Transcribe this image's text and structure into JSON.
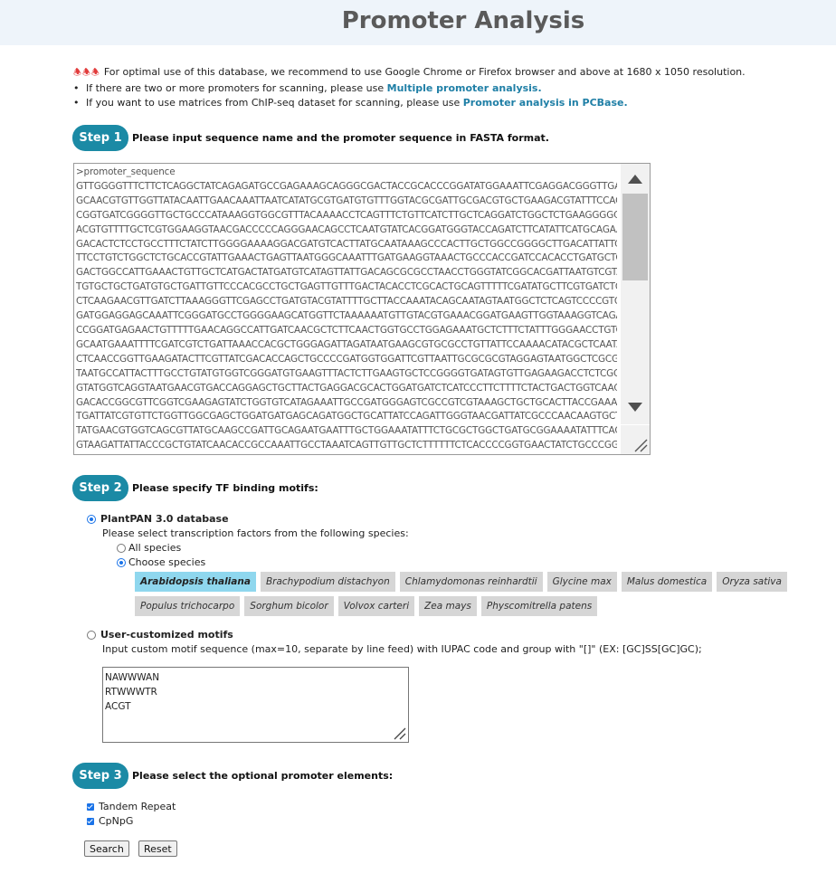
{
  "header": {
    "title": "Promoter Analysis"
  },
  "notices": {
    "browser_icon": "warning-icon",
    "browser_text": "For optimal use of this database, we recommend to use Google Chrome or Firefox browser and above at 1680 x 1050 resolution.",
    "multi_prefix": "If there are two or more promoters for scanning, please use ",
    "multi_link": "Multiple promoter analysis.",
    "chip_prefix": "If you want to use matrices from ChIP-seq dataset for scanning, please use ",
    "chip_link": "Promoter analysis in PCBase."
  },
  "step1": {
    "badge": "Step 1",
    "label": "Please input sequence name and the promoter sequence in FASTA format.",
    "sequence": ">promoter_sequence\nGTTGGGGTTTCTTCTCAGGCTATCAGAGATGCCGAGAAAGCAGGGCGACTACCGCACCCGGATATGGAAATTCGAGGACGGGTTGA\nGCAACGTGTTGGTTATACAATTGAACAAATTAATCATATGCGTGATGTGTTTGGTACGCGATTGCGACGTGCTGAAGACGTATTTCCAC\nCGGTGATCGGGGTTGCTGCCCATAAAGGTGGCGTTTACAAAACCTCAGTTTCTGTTCATCTTGCTCAGGATCTGGCTCTGAAGGGGCT\nACGTGTTTTGCTCGTGGAAGGTAACGACCCCCAGGGAACAGCCTCAATGTATCACGGATGGGTACCAGATCTTCATATTCATGCAGAA\nGACACTCTCCTGCCTTTCTATCTTGGGGAAAAGGACGATGTCACTTATGCAATAAAGCCCACTTGCTGGCCGGGGCTTGACATTATTCC\nTTCCTGTCTGGCTCTGCACCGTATTGAAACTGAGTTAATGGGCAAATTTGATGAAGGTAAACTGCCCACCGATCCACACCTGATGCTCC\nGACTGGCCATTGAAACTGTTGCTCATGACTATGATGTCATAGTTATTGACAGCGCGCCTAACCTGGGTATCGGCACGATTAATGTCGTA\nTGTGCTGCTGATGTGCTGATTGTTCCCACGCCTGCTGAGTTGTTTGACTACACCTCGCACTGCAGTTTTTCGATATGCTTCGTGATCTG\nCTCAAGAACGTTGATCTTAAAGGGTTCGAGCCTGATGTACGTATTTTGCTTACCAAATACAGCAATAGTAATGGCTCTCAGTCCCCGTG\nGATGGAGGAGCAAATTCGGGATGCCTGGGGAAGCATGGTTCTAAAAAATGTTGTACGTGAAACGGATGAAGTTGGTAAAGGTCAGAT\nCCGGATGAGAACTGTTTTTGAACAGGCCATTGATCAACGCTCTTCAACTGGTGCCTGGAGAAATGCTCTTTCTATTTGGGAACCTGTCT\nGCAATGAAATTTTCGATCGTCTGATTAAACCACGCTGGGAGATTAGATAATGAAGCGTGCGCCTGTTATTCCAAAACATACGCTCAATA\nCTCAACCGGTTGAAGATACTTCGTTATCGACACCAGCTGCCCCGATGGTGGATTCGTTAATTGCGCGCGTAGGAGTAATGGCTCGCGG\nTAATGCCATTACTTTGCCTGTATGTGGTCGGGATGTGAAGTTTACTCTTGAAGTGCTCCGGGGTGATAGTGTTGAGAAGACCTCTCGG\nGTATGGTCAGGTAATGAACGTGACCAGGAGCTGCTTACTGAGGACGCACTGGATGATCTCATCCCTTCTTTTCTACTGACTGGTCAACA\nGACACCGGCGTTCGGTCGAAGAGTATCTGGTGTCATAGAAATTGCCGATGGGAGTCGCCGTCGTAAAGCTGCTGCACTTACCGAAAG\nTGATTATCGTGTTCTGGTTGGCGAGCTGGATGATGAGCAGATGGCTGCATTATCCAGATTGGGTAACGATTATCGCCCAACAAGTGCT\nTATGAACGTGGTCAGCGTTATGCAAGCCGATTGCAGAATGAATTTGCTGGAAATATTTCTGCGCTGGCTGATGCGGAAAATATTTCAC\nGTAAGATTATTACCCGCTGTATCAACACCGCCAAATTGCCTAAATCAGTTGTTGCTCTTTTTTCTCACCCCGGTGAACTATCTGCCCGGT"
  },
  "step2": {
    "badge": "Step 2",
    "label": "Please specify TF binding motifs:",
    "db_option": "PlantPAN 3.0 database",
    "species_prompt": "Please select transcription factors from the following species:",
    "all_species": "All species",
    "choose_species": "Choose species",
    "species_row1": [
      "Arabidopsis thaliana",
      "Brachypodium distachyon",
      "Chlamydomonas reinhardtii",
      "Glycine max",
      "Malus domestica",
      "Oryza sativa"
    ],
    "species_row2": [
      "Populus trichocarpo",
      "Sorghum bicolor",
      "Volvox carteri",
      "Zea mays",
      "Physcomitrella patens"
    ],
    "selected_species": "Arabidopsis thaliana",
    "custom_option": "User-customized motifs",
    "custom_hint": "Input custom motif sequence (max=10, separate by line feed) with IUPAC code and group with \"[]\" (EX: [GC]SS[GC]GC);",
    "custom_value": "NAWWWAN\nRTWWWTR\nACGT"
  },
  "step3": {
    "badge": "Step 3",
    "label": "Please select the optional promoter elements:",
    "opt1": "Tandem Repeat",
    "opt2": "CpNpG"
  },
  "buttons": {
    "search": "Search",
    "reset": "Reset"
  },
  "colors": {
    "accent": "#1b8aa5",
    "link": "#1f7fa6",
    "selected_species": "#8fd7ee",
    "species_chip": "#d6d6d6"
  }
}
